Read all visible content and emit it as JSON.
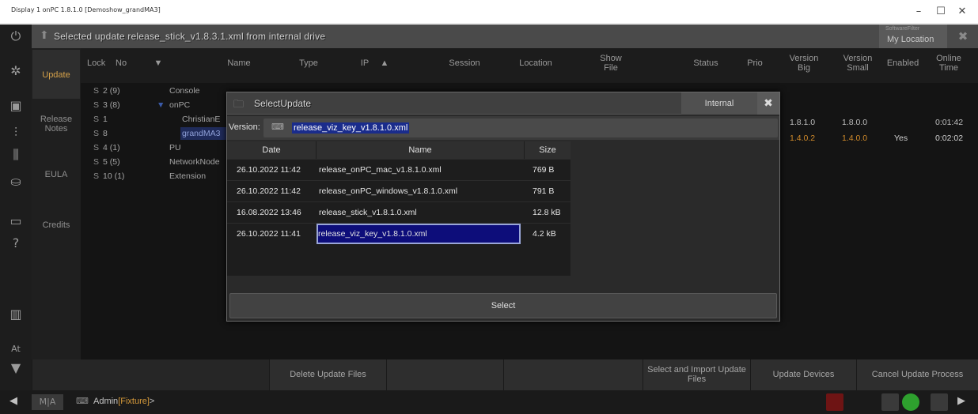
{
  "window": {
    "title": "Display 1 onPC 1.8.1.0 [Demoshow_grandMA3]",
    "min": "–",
    "max": "☐",
    "close": "✕"
  },
  "message_bar": {
    "text": "Selected update release_stick_v1.8.3.1.xml from internal drive",
    "software_filter_label": "SoftwareFilter",
    "software_filter_value": "My Location"
  },
  "tabs": [
    {
      "label": "Update",
      "active": true
    },
    {
      "label": "Release Notes",
      "active": false
    },
    {
      "label": "EULA",
      "active": false
    },
    {
      "label": "Credits",
      "active": false
    }
  ],
  "columns": {
    "lock": "Lock",
    "no": "No",
    "name": "Name",
    "type": "Type",
    "ip": "IP",
    "session": "Session",
    "location": "Location",
    "show_file": "Show File",
    "status": "Status",
    "prio": "Prio",
    "version_big": "Version Big",
    "version_small": "Version Small",
    "enabled": "Enabled",
    "online_time": "Online Time"
  },
  "devices": [
    {
      "lock": "S",
      "no": "2 (9)",
      "name": "Console"
    },
    {
      "lock": "S",
      "no": "3 (8)",
      "name": "onPC"
    },
    {
      "lock": "S",
      "no": "1",
      "name": "ChristianE"
    },
    {
      "lock": "S",
      "no": "8",
      "name": "grandMA3"
    },
    {
      "lock": "S",
      "no": "4 (1)",
      "name": "PU"
    },
    {
      "lock": "S",
      "no": "5 (5)",
      "name": "NetworkNode"
    },
    {
      "lock": "S",
      "no": "10 (1)",
      "name": "Extension"
    }
  ],
  "versions": [
    {
      "big": "1.8.1.0",
      "small": "1.8.0.0",
      "enabled": "",
      "online": "0:01:42"
    },
    {
      "big": "1.4.0.2",
      "small": "1.4.0.0",
      "enabled": "Yes",
      "online": "0:02:02"
    }
  ],
  "dialog": {
    "title": "SelectUpdate",
    "internal_label": "Internal",
    "version_label": "Version:",
    "version_value": "release_viz_key_v1.8.1.0.xml",
    "headers": {
      "date": "Date",
      "name": "Name",
      "size": "Size"
    },
    "files": [
      {
        "date": "26.10.2022 11:42",
        "name": "release_onPC_mac_v1.8.1.0.xml",
        "size": "769 B",
        "selected": false
      },
      {
        "date": "26.10.2022 11:42",
        "name": "release_onPC_windows_v1.8.1.0.xml",
        "size": "791 B",
        "selected": false
      },
      {
        "date": "16.08.2022 13:46",
        "name": "release_stick_v1.8.1.0.xml",
        "size": "12.8 kB",
        "selected": false
      },
      {
        "date": "26.10.2022 11:41",
        "name": "release_viz_key_v1.8.1.0.xml",
        "size": "4.2 kB",
        "selected": true
      }
    ],
    "select_button": "Select"
  },
  "buttons": {
    "delete_update_files": "Delete Update Files",
    "select_import": "Select and Import Update Files",
    "update_devices": "Update Devices",
    "cancel_update": "Cancel Update Process"
  },
  "command_line": {
    "logo": "M|A",
    "user": "Admin",
    "destination": "[Fixture]",
    "prompt": ">"
  },
  "left_icons": [
    "power-icon",
    "gear-icon",
    "window-icon",
    "faders-icon",
    "faders-alt-icon",
    "user-group-icon",
    "monitor-icon",
    "help-icon",
    "grid-icon",
    "at-icon",
    "filter-icon"
  ],
  "colors": {
    "accent_orange": "#d6a24a",
    "selection_blue": "#1a2c8c",
    "selected_row": "#0d0d7a",
    "status_green": "#2ea02e",
    "status_red": "#8a1b1b"
  }
}
